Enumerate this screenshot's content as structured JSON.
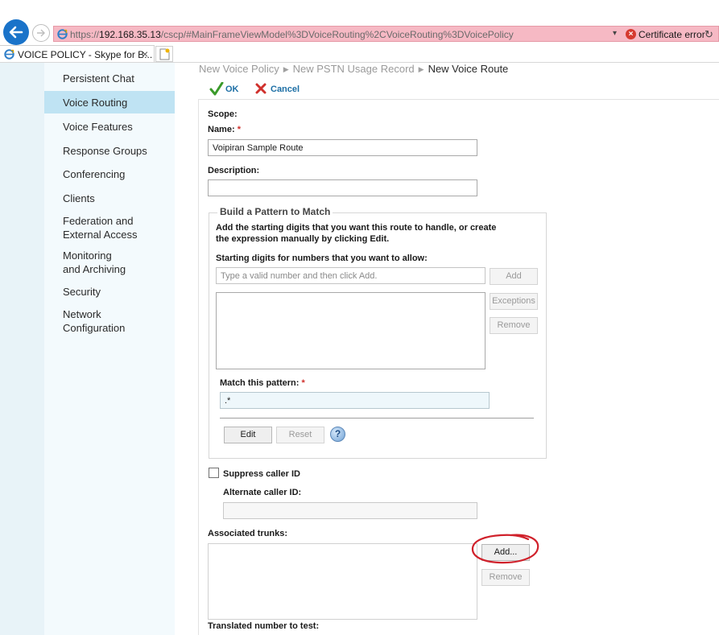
{
  "browser": {
    "url_prefix": "https://",
    "url_host": "192.168.35.13",
    "url_path": "/cscp/#MainFrameViewModel%3DVoiceRouting%2CVoiceRouting%3DVoicePolicy",
    "dropdown_glyph": "▾",
    "cert_error": "Certificate error",
    "tab_title": "VOICE POLICY - Skype for B...",
    "tab_close": "×",
    "colors": {
      "address_bar_error": "#f6b9c4",
      "back_button": "#1a73c9"
    }
  },
  "nav": {
    "items": [
      {
        "label": "Persistent Chat"
      },
      {
        "label": "Voice Routing",
        "active": true
      },
      {
        "label": "Voice Features"
      },
      {
        "label": "Response Groups"
      },
      {
        "label": "Conferencing"
      },
      {
        "label": "Clients"
      },
      {
        "label": "Federation and\nExternal Access"
      },
      {
        "label": "Monitoring\nand Archiving"
      },
      {
        "label": "Security"
      },
      {
        "label": "Network\nConfiguration"
      }
    ],
    "active_color": "#bfe3f3"
  },
  "breadcrumb": {
    "items": [
      "New Voice Policy",
      "New PSTN Usage Record",
      "New Voice Route"
    ]
  },
  "toolbar": {
    "ok_label": "OK",
    "cancel_label": "Cancel"
  },
  "form": {
    "scope_label": "Scope:",
    "name_label": "Name:",
    "required_mark": "*",
    "name_value": "Voipiran Sample Route",
    "description_label": "Description:",
    "description_value": "",
    "pattern": {
      "title": "Build a Pattern to Match",
      "description": "Add the starting digits that you want this route to handle, or create the expression manually by clicking Edit.",
      "starting_digits_label": "Starting digits for numbers that you want to allow:",
      "starting_digits_placeholder": "Type a valid number and then click Add.",
      "add_label": "Add",
      "exceptions_label": "Exceptions",
      "remove_label": "Remove",
      "match_label": "Match this pattern:",
      "match_value": ".*",
      "edit_label": "Edit",
      "reset_label": "Reset",
      "help_glyph": "?"
    },
    "suppress_caller_id_label": "Suppress caller ID",
    "suppress_caller_id_checked": false,
    "alternate_caller_id_label": "Alternate caller ID:",
    "alternate_caller_id_value": "",
    "associated_trunks_label": "Associated trunks:",
    "trunks_add_label": "Add...",
    "trunks_remove_label": "Remove",
    "translated_number_label": "Translated number to test:",
    "annotation_color": "#d0212b"
  }
}
